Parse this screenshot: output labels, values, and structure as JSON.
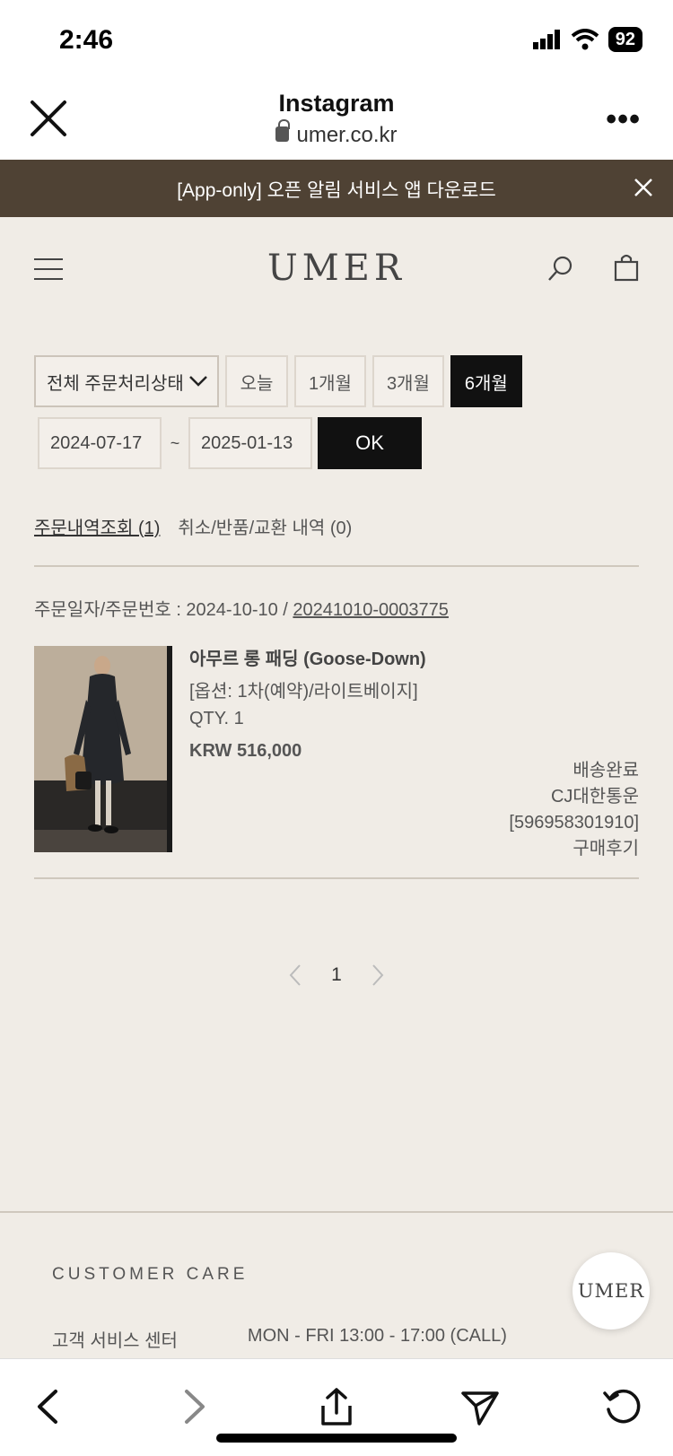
{
  "status_bar": {
    "time": "2:46",
    "battery": "92"
  },
  "browser": {
    "title": "Instagram",
    "url": "umer.co.kr"
  },
  "promo": {
    "text": "[App-only] 오픈 알림 서비스 앱 다운로드"
  },
  "site": {
    "logo": "UMER"
  },
  "filters": {
    "status_select": "전체 주문처리상태",
    "periods": [
      "오늘",
      "1개월",
      "3개월",
      "6개월"
    ],
    "active_period": "6개월",
    "date_from": "2024-07-17",
    "date_to": "2025-01-13",
    "ok_label": "OK"
  },
  "tabs": {
    "orders": "주문내역조회 (1)",
    "cancels": "취소/반품/교환 내역 (0)"
  },
  "order": {
    "meta_label": "주문일자/주문번호 : 2024-10-10 / ",
    "order_no": "20241010-0003775",
    "product_name": "아무르 롱 패딩 (Goose-Down)",
    "option": "[옵션: 1차(예약)/라이트베이지]",
    "qty": "QTY. 1",
    "price": "KRW 516,000",
    "status": "배송완료",
    "carrier": "CJ대한통운",
    "tracking": "[596958301910]",
    "review": "구매후기"
  },
  "pagination": {
    "current": "1"
  },
  "footer": {
    "title": "CUSTOMER CARE",
    "cs_label": "고객 서비스 센터",
    "cs_hours": "MON - FRI 13:00 - 17:00 (CALL)",
    "float_logo": "UMER"
  }
}
